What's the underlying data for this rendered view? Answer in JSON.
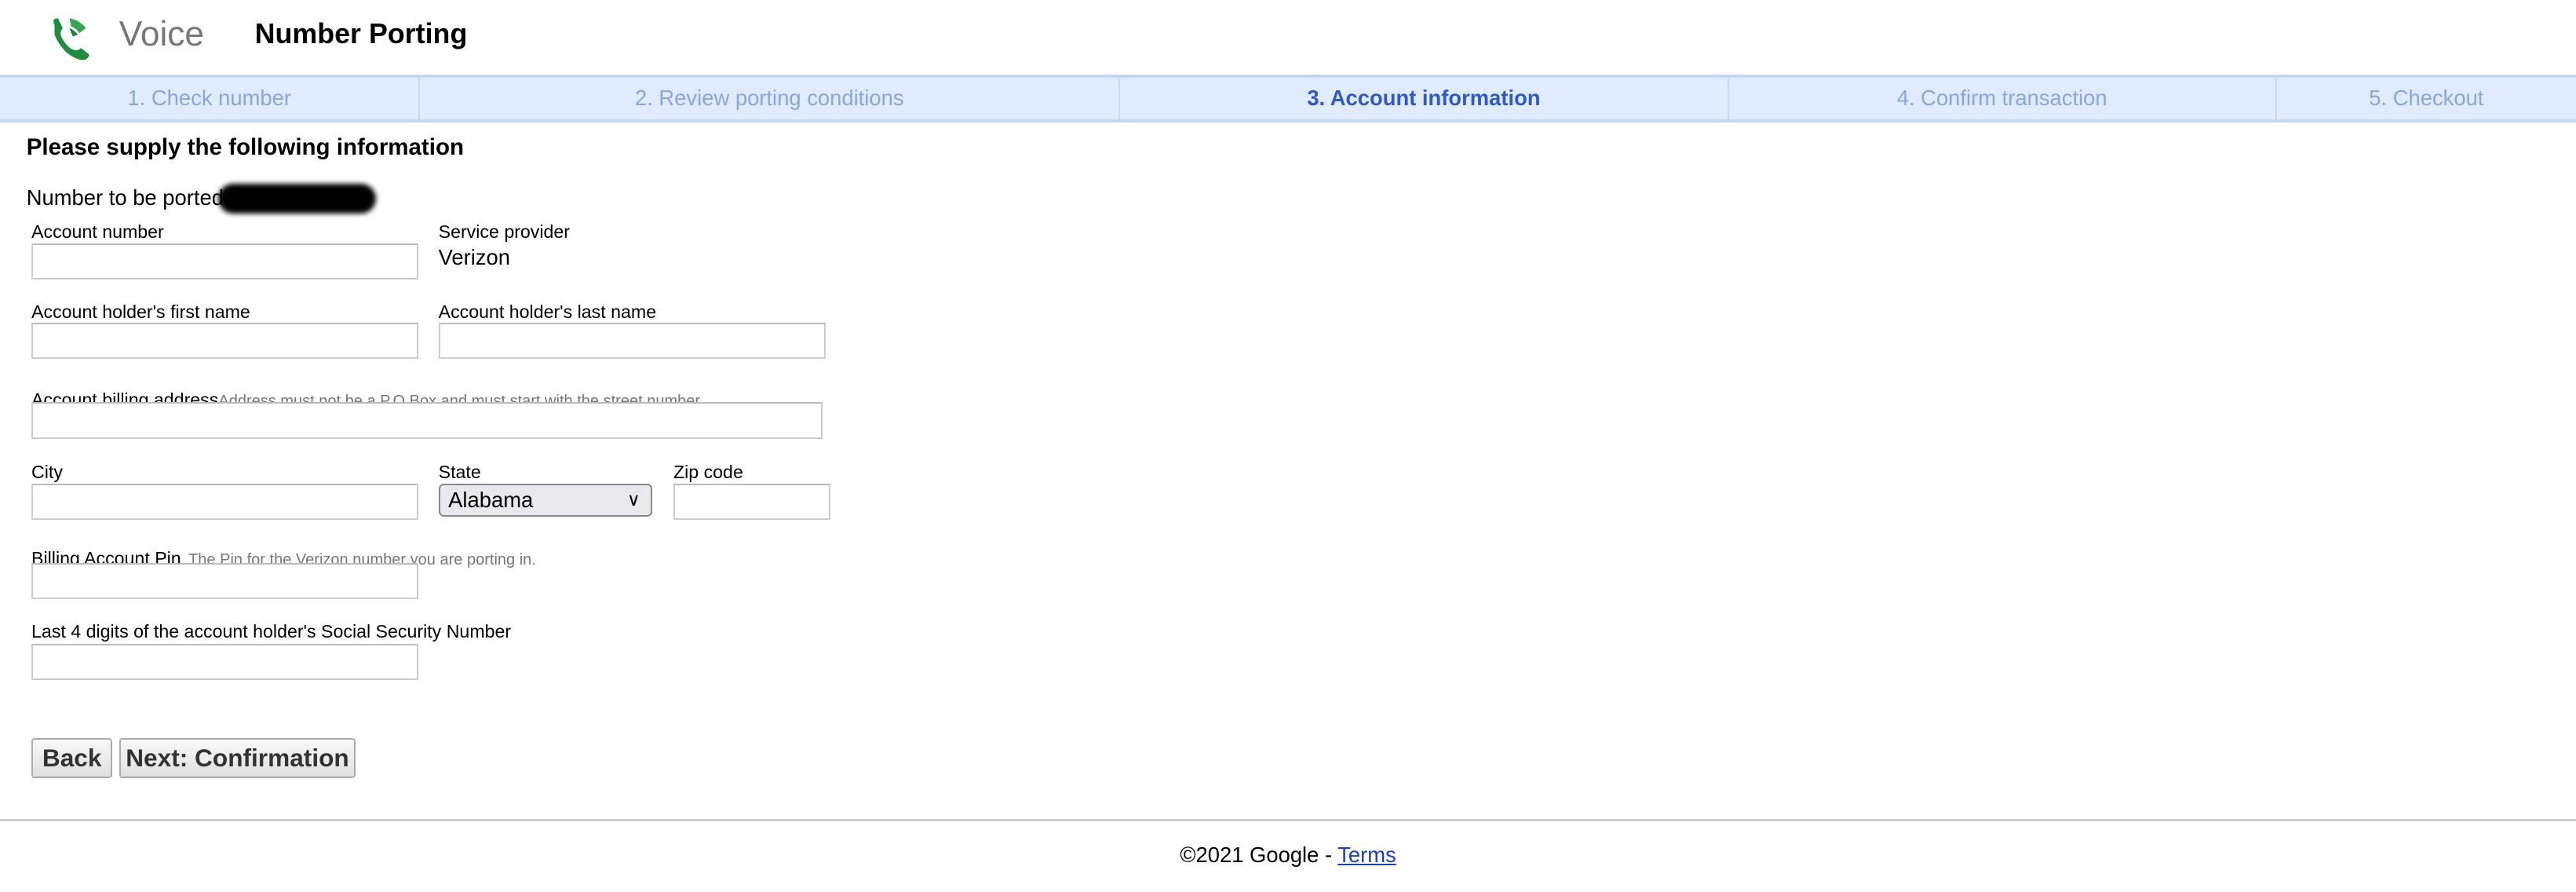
{
  "header": {
    "logo_text": "Voice",
    "title": "Number Porting",
    "brand_color": "#1e8e3e"
  },
  "steps": [
    {
      "label": "1. Check number",
      "active": false
    },
    {
      "label": "2. Review porting conditions",
      "active": false
    },
    {
      "label": "3. Account information",
      "active": true
    },
    {
      "label": "4. Confirm transaction",
      "active": false
    },
    {
      "label": "5. Checkout",
      "active": false
    }
  ],
  "form": {
    "heading": "Please supply the following information",
    "number_label": "Number to be ported:",
    "account_number": {
      "label": "Account number",
      "value": ""
    },
    "service_provider": {
      "label": "Service provider",
      "value": "Verizon"
    },
    "first_name": {
      "label": "Account holder's first name",
      "value": ""
    },
    "last_name": {
      "label": "Account holder's last name",
      "value": ""
    },
    "billing_address": {
      "label": "Account billing address",
      "hint": "Address must not be a P.O.Box and must start with the street number.",
      "value": ""
    },
    "city": {
      "label": "City",
      "value": ""
    },
    "state": {
      "label": "State",
      "value": "Alabama"
    },
    "zip": {
      "label": "Zip code",
      "value": ""
    },
    "pin": {
      "label": "Billing Account Pin",
      "hint": "The Pin for the Verizon number you are porting in.",
      "value": ""
    },
    "ssn": {
      "label": "Last 4 digits of the account holder's Social Security Number",
      "value": ""
    }
  },
  "buttons": {
    "back": "Back",
    "next": "Next: Confirmation"
  },
  "footer": {
    "copyright": "©2021 Google - ",
    "terms": "Terms"
  }
}
